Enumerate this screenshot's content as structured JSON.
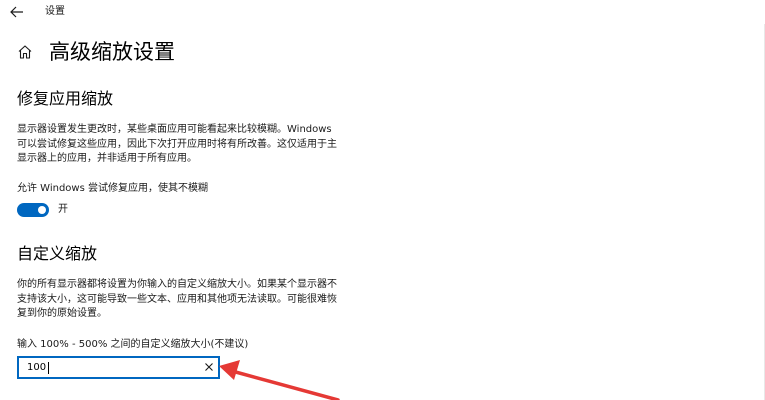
{
  "window": {
    "title": "设置"
  },
  "page": {
    "title": "高级缩放设置"
  },
  "fix_scaling": {
    "heading": "修复应用缩放",
    "description_lines": [
      "显示器设置发生更改时，某些桌面应用可能看起来比较模糊。Windows",
      "可以尝试修复这些应用，因此下次打开应用时将有所改善。这仅适用于主",
      "显示器上的应用，并非适用于所有应用。"
    ],
    "toggle_label": "允许 Windows 尝试修复应用，使其不模糊",
    "toggle_state": "开",
    "toggle_on": true
  },
  "custom_scaling": {
    "heading": "自定义缩放",
    "description_lines": [
      "你的所有显示器都将设置为你输入的自定义缩放大小。如果某个显示器不",
      "支持该大小，这可能导致一些文本、应用和其他项无法读取。可能很难恢",
      "复到你的原始设置。"
    ],
    "input_label": "输入 100% - 500% 之间的自定义缩放大小(不建议)",
    "input_value": "100"
  },
  "colors": {
    "accent": "#0067c0",
    "annotation_arrow": "#e53935"
  },
  "icons": {
    "back": "back-arrow-icon",
    "home": "home-icon",
    "clear": "close-icon"
  }
}
